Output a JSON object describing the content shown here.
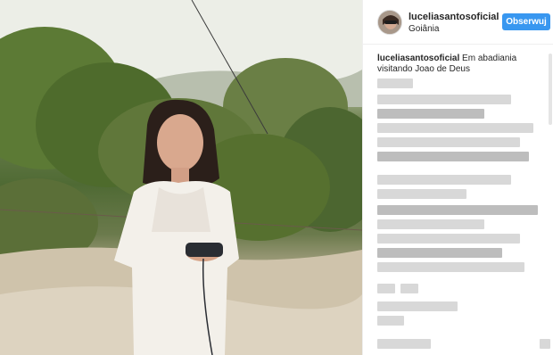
{
  "post": {
    "username": "luceliasantosoficial",
    "location": "Goiânia",
    "follow_label": "Obserwuj",
    "caption_user": "luceliasantosoficial",
    "caption_text": "Em abadiania visitando Joao de Deus"
  },
  "icons": {
    "avatar": "avatar-photo"
  },
  "colors": {
    "accent": "#3897f0",
    "text": "#262626",
    "border": "#efefef"
  }
}
